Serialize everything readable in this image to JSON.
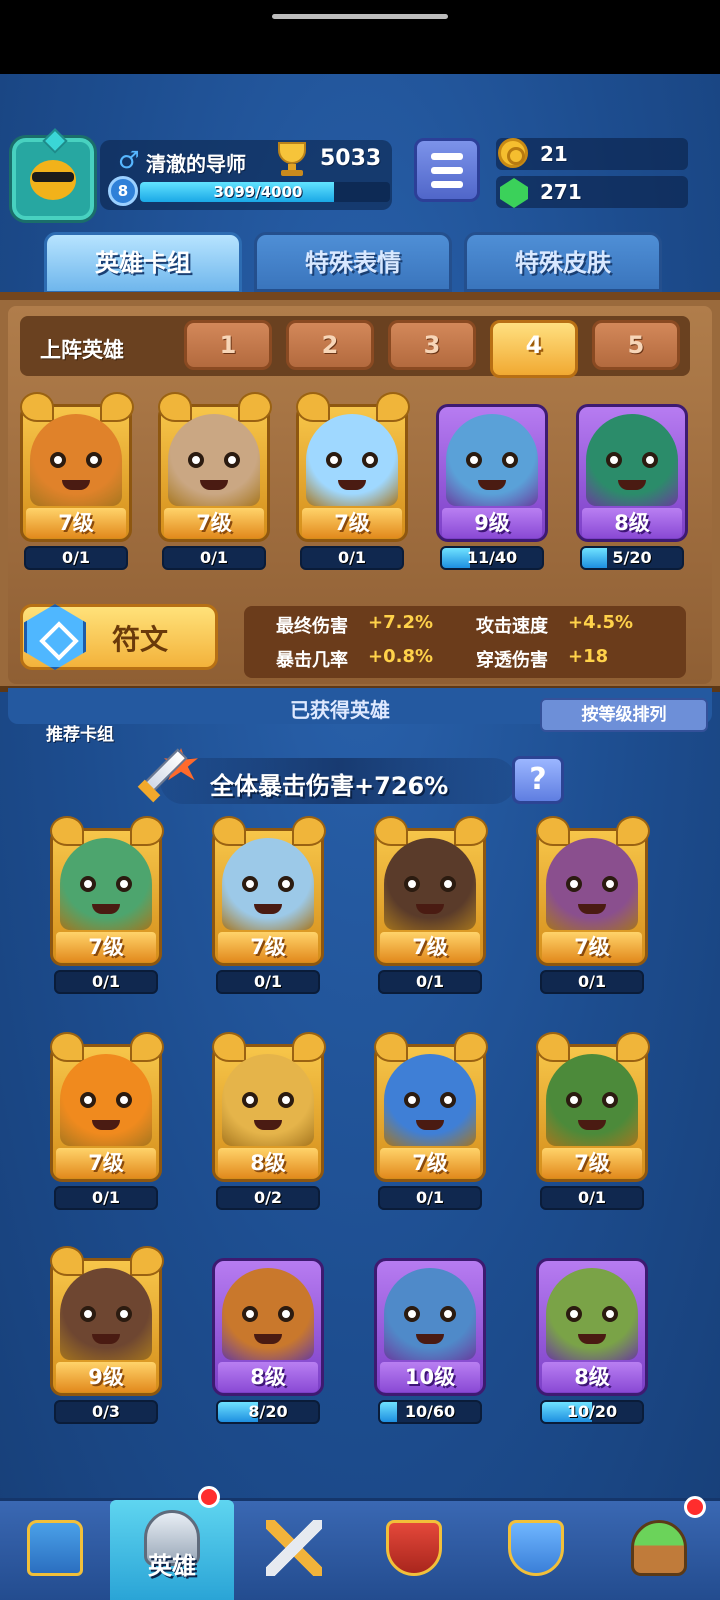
{
  "player": {
    "name": "清澈的导师",
    "gender_icon": "♂",
    "trophies": "5033",
    "level": "8",
    "xp_text": "3099/4000",
    "xp_fraction": 0.775
  },
  "currency": {
    "coins": "21",
    "gems": "271"
  },
  "tabs": [
    "英雄卡组",
    "特殊表情",
    "特殊皮肤"
  ],
  "lineup": {
    "label": "上阵英雄",
    "slots": [
      "1",
      "2",
      "3",
      "4",
      "5"
    ],
    "active_slot": 3,
    "heroes": [
      {
        "level": "7级",
        "count": "0/1",
        "progress": 0,
        "rarity": "legendary",
        "color": "#e0822a",
        "icon": "gold-hero-portrait"
      },
      {
        "level": "7级",
        "count": "0/1",
        "progress": 0,
        "rarity": "legendary",
        "color": "#caa783",
        "icon": "bull-hero-portrait"
      },
      {
        "level": "7级",
        "count": "0/1",
        "progress": 0,
        "rarity": "legendary",
        "color": "#9fd8ff",
        "icon": "girl-hero-portrait"
      },
      {
        "level": "9级",
        "count": "11/40",
        "progress": 0.275,
        "rarity": "epic",
        "color": "#5aa1d8",
        "icon": "blue-hero-portrait"
      },
      {
        "level": "8级",
        "count": "5/20",
        "progress": 0.25,
        "rarity": "epic",
        "color": "#2b8c6a",
        "icon": "skull-hero-portrait"
      }
    ]
  },
  "rune": {
    "label": "符文",
    "stats": [
      {
        "name": "最终伤害",
        "value": "+7.2%"
      },
      {
        "name": "攻击速度",
        "value": "+4.5%"
      },
      {
        "name": "暴击几率",
        "value": "+0.8%"
      },
      {
        "name": "穿透伤害",
        "value": "+18"
      }
    ]
  },
  "collection": {
    "recommended_label": "推荐卡组",
    "owned_label": "已获得英雄",
    "sort_label": "按等级排列",
    "crit_bonus": "全体暴击伤害+726%",
    "help_label": "?",
    "heroes": [
      {
        "level": "7级",
        "count": "0/1",
        "progress": 0,
        "rarity": "legendary",
        "color": "#4da56e",
        "icon": "police-hero-portrait"
      },
      {
        "level": "7级",
        "count": "0/1",
        "progress": 0,
        "rarity": "legendary",
        "color": "#9cc9e8",
        "icon": "zeus-hero-portrait"
      },
      {
        "level": "7级",
        "count": "0/1",
        "progress": 0,
        "rarity": "legendary",
        "color": "#5a3b2a",
        "icon": "hooded-hero-portrait"
      },
      {
        "level": "7级",
        "count": "0/1",
        "progress": 0,
        "rarity": "legendary",
        "color": "#8a4f8e",
        "icon": "skull-mage-hero-portrait"
      },
      {
        "level": "7级",
        "count": "0/1",
        "progress": 0,
        "rarity": "legendary",
        "color": "#f08a1e",
        "icon": "orange-hero-portrait"
      },
      {
        "level": "8级",
        "count": "0/2",
        "progress": 0,
        "rarity": "legendary",
        "color": "#e5b44a",
        "icon": "knight-hero-portrait"
      },
      {
        "level": "7级",
        "count": "0/1",
        "progress": 0,
        "rarity": "legendary",
        "color": "#3f7fd6",
        "icon": "ice-hero-portrait"
      },
      {
        "level": "7级",
        "count": "0/1",
        "progress": 0,
        "rarity": "legendary",
        "color": "#4c8a3a",
        "icon": "zombie-hero-portrait"
      },
      {
        "level": "9级",
        "count": "0/3",
        "progress": 0,
        "rarity": "legendary",
        "color": "#6e4631",
        "icon": "lava-hero-portrait"
      },
      {
        "level": "8级",
        "count": "8/20",
        "progress": 0.4,
        "rarity": "epic",
        "color": "#c9782c",
        "icon": "golem-hero-portrait"
      },
      {
        "level": "10级",
        "count": "10/60",
        "progress": 0.167,
        "rarity": "epic",
        "color": "#4f8ac9",
        "icon": "thief-hero-portrait"
      },
      {
        "level": "8级",
        "count": "10/20",
        "progress": 0.5,
        "rarity": "epic",
        "color": "#7aa347",
        "icon": "ranger-hero-portrait"
      }
    ]
  },
  "nav": {
    "items": [
      {
        "name": "chest",
        "label": "",
        "icon": "treasure-chest-icon",
        "active": false,
        "dot": false
      },
      {
        "name": "heroes",
        "label": "英雄",
        "icon": "knight-helmet-icon",
        "active": true,
        "dot": true
      },
      {
        "name": "battle",
        "label": "",
        "icon": "crossed-swords-icon",
        "active": false,
        "dot": false
      },
      {
        "name": "rank",
        "label": "",
        "icon": "crown-shield-icon",
        "active": false,
        "dot": false
      },
      {
        "name": "social",
        "label": "",
        "icon": "friends-shield-icon",
        "active": false,
        "dot": false
      },
      {
        "name": "garden",
        "label": "",
        "icon": "sprout-island-icon",
        "active": false,
        "dot": true
      }
    ]
  },
  "colors": {
    "accent": "#f3b23b",
    "epic": "#8a4ad5",
    "background": "#1c4a86"
  }
}
